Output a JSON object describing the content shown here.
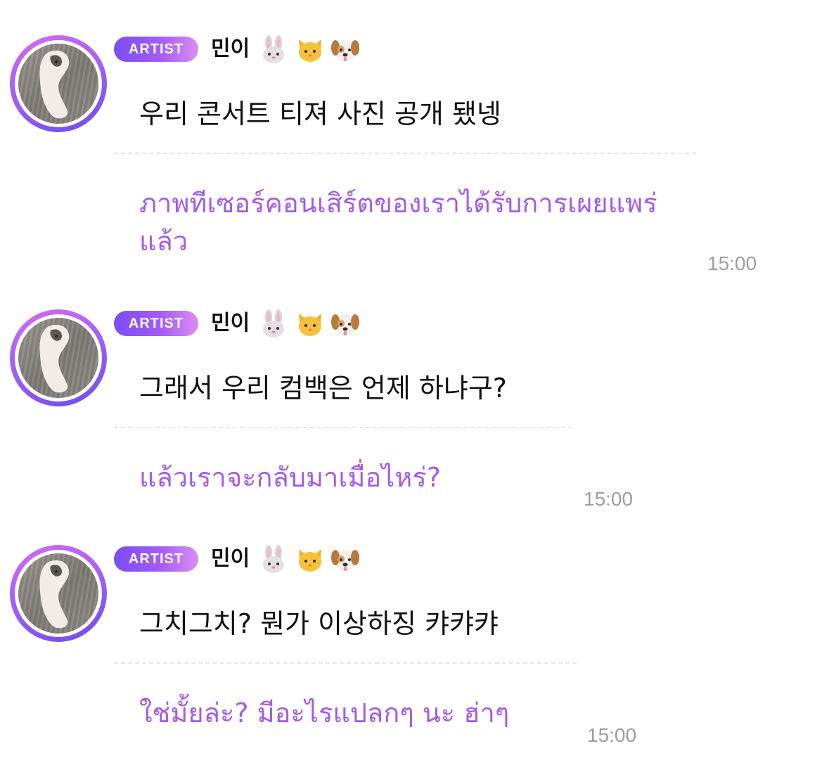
{
  "messages": [
    {
      "badge": "ARTIST",
      "name": "민이",
      "emojis": [
        "rabbit-face-icon",
        "cat-face-icon",
        "dog-face-icon"
      ],
      "text": "우리 콘서트 티져 사진 공개 됐넹",
      "translation": "ภาพทีเซอร์คอนเสิร์ตของเราได้รับการเผยแพร่แล้ว",
      "time": "15:00"
    },
    {
      "badge": "ARTIST",
      "name": "민이",
      "emojis": [
        "rabbit-face-icon",
        "cat-face-icon",
        "dog-face-icon"
      ],
      "text": "그래서 우리 컴백은 언제 하냐구?",
      "translation": "แล้วเราจะกลับมาเมื่อไหร่?",
      "time": "15:00"
    },
    {
      "badge": "ARTIST",
      "name": "민이",
      "emojis": [
        "rabbit-face-icon",
        "cat-face-icon",
        "dog-face-icon"
      ],
      "text": "그치그치? 뭔가 이상하징 캬캬캬",
      "translation": "ใช่มั้ยล่ะ? มีอะไรแปลกๆ นะ ฮ่าๆ",
      "time": "15:00"
    }
  ],
  "colors": {
    "accent": "#a25ce8",
    "badge_start": "#7a4df4",
    "badge_end": "#d98ef3",
    "timestamp": "#9e9e9e",
    "divider": "#e6e6e6"
  }
}
